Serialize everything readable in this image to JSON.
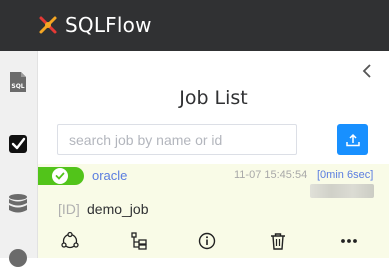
{
  "app": {
    "name": "SQLFlow",
    "brand_color": "#303133",
    "accent_color": "#1890ff",
    "logo_icon": "sqlflow-logo-icon"
  },
  "sidebar": {
    "items": [
      {
        "icon": "sql-file-icon",
        "label": "SQL",
        "active": false
      },
      {
        "icon": "job-checkbox-icon",
        "active": true
      },
      {
        "icon": "database-icon",
        "active": false
      },
      {
        "icon": "info-circle-icon",
        "active": false
      }
    ]
  },
  "panel": {
    "collapse_icon": "chevron-left-icon",
    "title": "Job List",
    "search": {
      "placeholder": "search job by name or id",
      "value": ""
    },
    "upload_icon": "upload-icon"
  },
  "jobs": [
    {
      "status": "success",
      "status_color": "#52c41a",
      "db_vendor": "oracle",
      "time": "11-07 15:45:54",
      "duration": "[0min 6sec]",
      "id_label": "[ID]",
      "name": "demo_job",
      "actions": [
        "lineage-graph-icon",
        "tree-icon",
        "info-icon",
        "trash-icon",
        "more-icon"
      ]
    }
  ]
}
